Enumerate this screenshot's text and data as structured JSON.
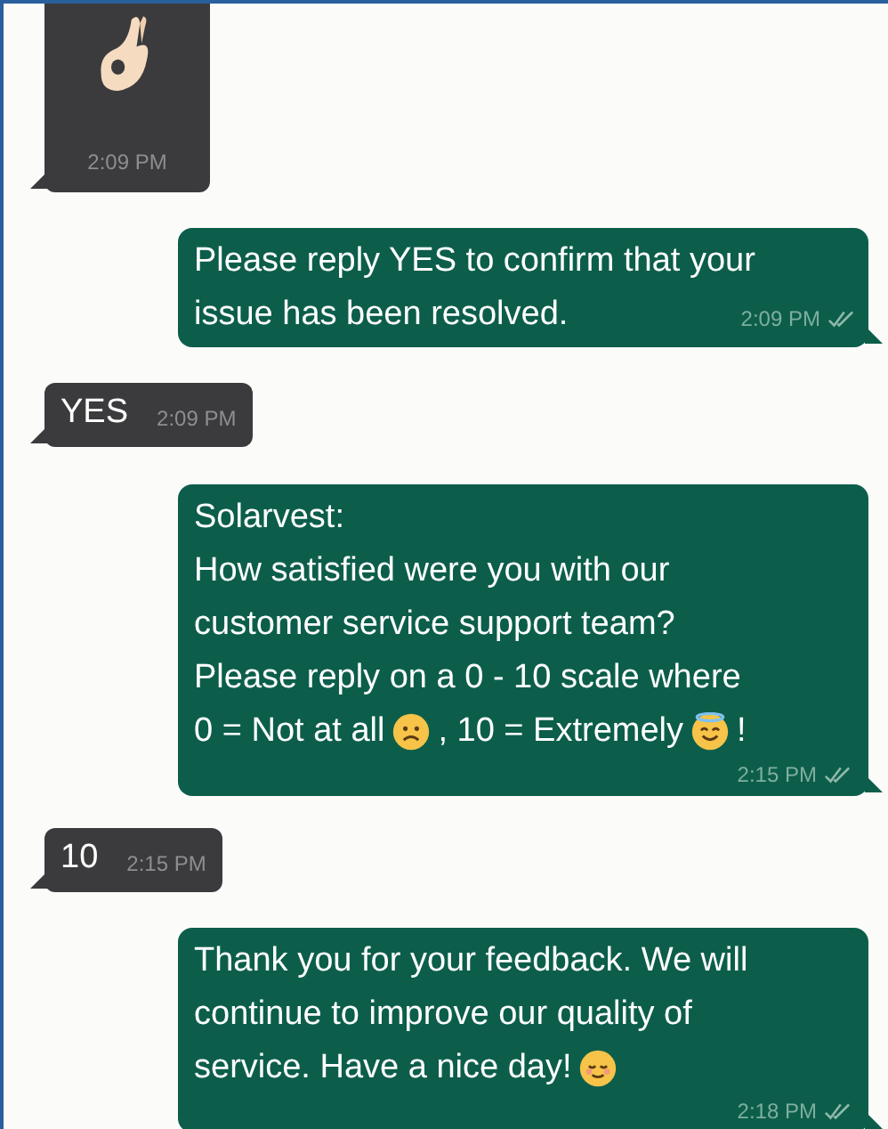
{
  "messages": [
    {
      "from_me": false,
      "kind": "image",
      "time": "2:09 PM"
    },
    {
      "from_me": true,
      "kind": "text",
      "lines": [
        [
          {
            "kind": "text",
            "text": "Please reply YES to confirm that your"
          }
        ],
        [
          {
            "kind": "text",
            "text": "issue has been resolved."
          }
        ]
      ],
      "time": "2:09 PM"
    },
    {
      "from_me": false,
      "kind": "text",
      "lines": [
        [
          {
            "kind": "text",
            "text": "YES"
          }
        ]
      ],
      "time": "2:09 PM"
    },
    {
      "from_me": true,
      "kind": "text",
      "lines": [
        [
          {
            "kind": "text",
            "text": "Solarvest:"
          }
        ],
        [
          {
            "kind": "text",
            "text": "How satisfied were you with our"
          }
        ],
        [
          {
            "kind": "text",
            "text": "customer service support team?"
          }
        ],
        [
          {
            "kind": "text",
            "text": "Please reply on a 0 - 10 scale where"
          }
        ],
        [
          {
            "kind": "text",
            "text": "0 = Not at all"
          },
          {
            "kind": "sad_face"
          },
          {
            "kind": "text",
            "text": ", 10 = Extremely"
          },
          {
            "kind": "halo_face"
          },
          {
            "kind": "text",
            "text": "!"
          }
        ]
      ],
      "time": "2:15 PM"
    },
    {
      "from_me": false,
      "kind": "text",
      "lines": [
        [
          {
            "kind": "text",
            "text": "10"
          }
        ]
      ],
      "time": "2:15 PM"
    },
    {
      "from_me": true,
      "kind": "text",
      "lines": [
        [
          {
            "kind": "text",
            "text": "Thank you for your feedback. We will"
          }
        ],
        [
          {
            "kind": "text",
            "text": "continue to improve our quality of"
          }
        ],
        [
          {
            "kind": "text",
            "text": "service. Have a nice day!"
          },
          {
            "kind": "relieved_face"
          }
        ]
      ],
      "time": "2:18 PM"
    }
  ]
}
